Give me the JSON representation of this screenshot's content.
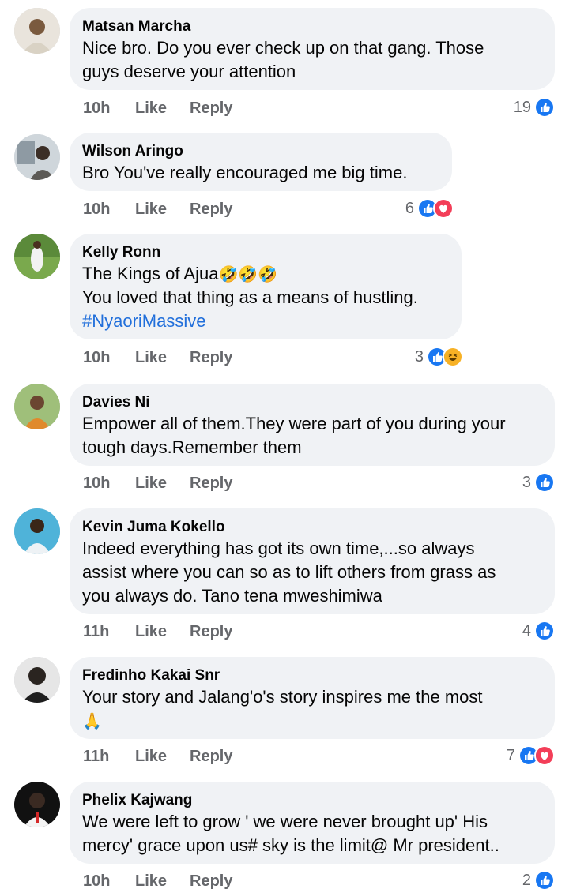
{
  "colors": {
    "like_blue": "#1877f2",
    "love_red": "#f33e58",
    "haha_yellow": "#f7b125",
    "hashtag": "#216fdb",
    "muted": "#65676b"
  },
  "actions": {
    "like_label": "Like",
    "reply_label": "Reply"
  },
  "comments": [
    {
      "author": "Matsan Marcha",
      "text": "Nice bro. Do you ever check up on that gang. Those\nguys deserve your attention",
      "time": "10h",
      "reaction_count": "19",
      "reactions": [
        "like-icon"
      ]
    },
    {
      "author": "Wilson Aringo",
      "text": "Bro You've really encouraged me big time.",
      "time": "10h",
      "reaction_count": "6",
      "reactions": [
        "like-icon",
        "love-icon"
      ]
    },
    {
      "author": "Kelly Ronn",
      "text_line1": "The Kings of Ajua",
      "emoji_line1": "🤣🤣🤣",
      "text_line2": "You loved that thing as a means of hustling.",
      "hashtag": "#NyaoriMassive",
      "time": "10h",
      "reaction_count": "3",
      "reactions": [
        "like-icon",
        "haha-icon"
      ]
    },
    {
      "author": "Davies Ni",
      "text": "Empower all of them.They were part of you during your\ntough days.Remember them",
      "time": "10h",
      "reaction_count": "3",
      "reactions": [
        "like-icon"
      ]
    },
    {
      "author": "Kevin Juma Kokello",
      "text": "Indeed everything has got its own time,...so always\nassist where you can so as to lift others from grass as\nyou always do. Tano tena mweshimiwa",
      "time": "11h",
      "reaction_count": "4",
      "reactions": [
        "like-icon"
      ]
    },
    {
      "author": "Fredinho Kakai Snr",
      "text": "Your story and Jalang'o's story inspires me the most",
      "emoji_line": "🙏",
      "time": "11h",
      "reaction_count": "7",
      "reactions": [
        "like-icon",
        "love-icon"
      ]
    },
    {
      "author": "Phelix Kajwang",
      "text": "We were left to grow ' we were never brought up' His\nmercy' grace upon us# sky is the limit@ Mr president..",
      "time": "10h",
      "reaction_count": "2",
      "reactions": [
        "like-icon"
      ]
    }
  ]
}
